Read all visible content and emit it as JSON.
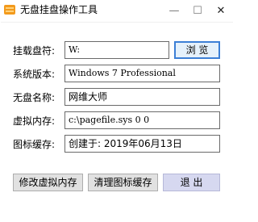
{
  "window": {
    "title": "无盘挂盘操作工具",
    "minimize_glyph": "—",
    "maximize_glyph": "☐",
    "close_glyph": "✕"
  },
  "form": {
    "mount_label": "挂载盘符:",
    "mount_value": "W:",
    "browse_label": "浏 览",
    "os_label": "系统版本:",
    "os_value": "Windows 7 Professional",
    "name_label": "无盘名称:",
    "name_value": "网维大师",
    "vmem_label": "虚拟内存:",
    "vmem_value": "c:\\pagefile.sys 0 0",
    "icon_label": "图标缓存:",
    "icon_value": "创建于: 2019年06月13日"
  },
  "actions": {
    "modify_vmem": "修改虚拟内存",
    "clear_icon_cache": "清理图标缓存",
    "exit": "退  出"
  },
  "colors": {
    "accent": "#3c7fd6",
    "icon_orange": "#f39a1c"
  }
}
